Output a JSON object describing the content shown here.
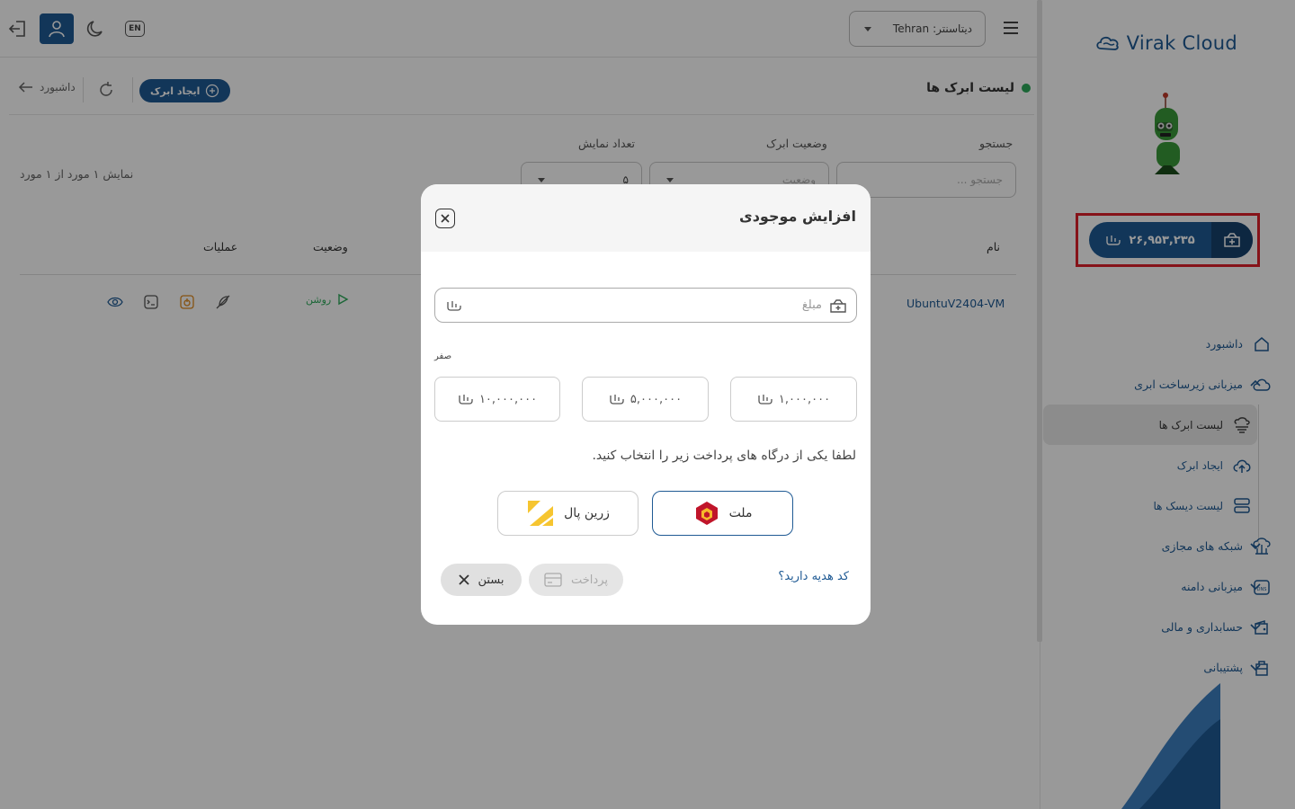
{
  "brand": {
    "logo_text": "Virak Cloud"
  },
  "wallet": {
    "balance": "۲۶,۹۵۳,۲۳۵"
  },
  "sidebar": {
    "items": [
      {
        "label": "داشبورد"
      },
      {
        "label": "میزبانی زیرساخت ابری"
      },
      {
        "label": "شبکه های مجازی"
      },
      {
        "label": "میزبانی دامنه"
      },
      {
        "label": "حسابداری و مالی"
      },
      {
        "label": "پشتیبانی"
      }
    ],
    "sub_items": [
      {
        "label": "لیست ابرک ها"
      },
      {
        "label": "ایجاد ابرک"
      },
      {
        "label": "لیست دیسک ها"
      }
    ]
  },
  "topbar": {
    "datacenter_label": "دیتاسنتر:",
    "datacenter_value": "Tehran",
    "lang": "EN"
  },
  "page": {
    "title": "لیست ابرک ها",
    "back_label": "داشبورد",
    "create_label": "ایجاد ابرک"
  },
  "filters": {
    "search_label": "جستجو",
    "search_placeholder": "جستجو ...",
    "status_label": "وضعیت ابرک",
    "status_placeholder": "وضعیت",
    "count_label": "تعداد نمایش",
    "count_value": "۵",
    "summary": "نمایش ۱ مورد از ۱ مورد"
  },
  "table": {
    "headers": {
      "name": "نام",
      "status": "وضعیت",
      "ops": "عملیات"
    },
    "rows": [
      {
        "name": "UbuntuV2404-VM",
        "status": "روشن"
      }
    ]
  },
  "modal": {
    "title": "افزایش موجودی",
    "amount_placeholder": "مبلغ",
    "amount_words": "صفر",
    "presets": [
      "۱۰,۰۰۰,۰۰۰",
      "۵,۰۰۰,۰۰۰",
      "۱,۰۰۰,۰۰۰"
    ],
    "gateway_note": "لطفا یکی از درگاه های پرداخت زیر را انتخاب کنید.",
    "gateways": [
      "ملت",
      "زرین پال"
    ],
    "gift_link": "کد هدیه دارید؟",
    "pay_label": "پرداخت",
    "close_label": "بستن"
  },
  "colors": {
    "primary": "#1f5a94",
    "success": "#2daa5b",
    "highlight": "#e0212a"
  }
}
